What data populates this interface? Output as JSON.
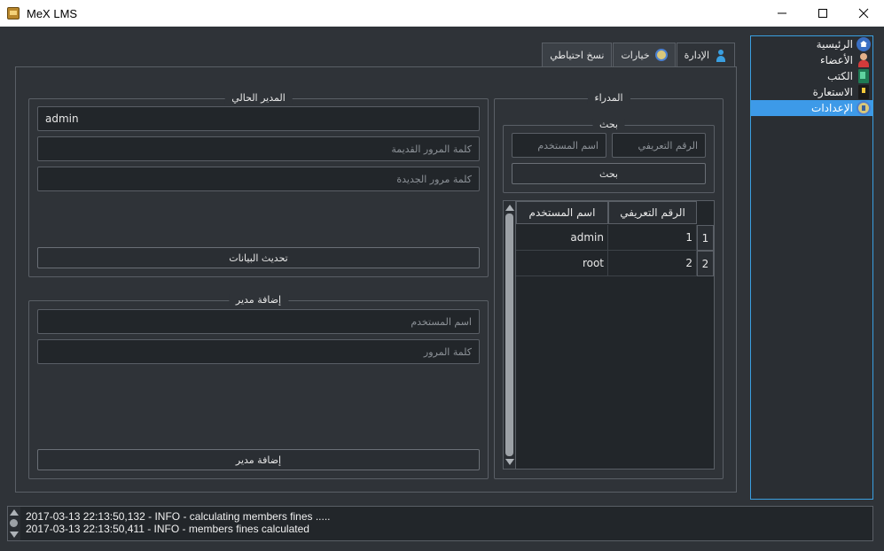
{
  "window": {
    "title": "MeX LMS",
    "controls": {
      "minimize": "—",
      "maximize": "☐",
      "close": "✕"
    }
  },
  "nav": {
    "items": [
      {
        "label": "الرئيسية",
        "icon": "home-icon"
      },
      {
        "label": "الأعضاء",
        "icon": "member-icon"
      },
      {
        "label": "الكتب",
        "icon": "book-icon"
      },
      {
        "label": "الاستعارة",
        "icon": "borrow-icon"
      },
      {
        "label": "الإعدادات",
        "icon": "settings-icon",
        "active": true
      }
    ]
  },
  "tabs": [
    {
      "label": "الإدارة",
      "icon": "user-icon",
      "active": true
    },
    {
      "label": "خيارات",
      "icon": "gear-icon"
    },
    {
      "label": "نسخ احتياطي"
    }
  ],
  "current_admin": {
    "title": "المدير الحالي",
    "username_value": "admin",
    "old_password_placeholder": "كلمة المرور القديمة",
    "new_password_placeholder": "كلمة مرور الجديدة",
    "update_button": "تحديث البيانات"
  },
  "add_admin": {
    "title": "إضافة مدير",
    "username_placeholder": "اسم المستخدم",
    "password_placeholder": "كلمة المرور",
    "add_button": "إضافة مدير"
  },
  "admins": {
    "title": "المدراء",
    "search": {
      "title": "بحث",
      "username_placeholder": "اسم المستخدم",
      "id_placeholder": "الرقم التعريفي",
      "button": "بحث"
    },
    "table": {
      "columns": [
        "اسم المستخدم",
        "الرقم التعريفي"
      ],
      "rows": [
        {
          "row_number": "1",
          "username": "admin",
          "id": "1"
        },
        {
          "row_number": "2",
          "username": "root",
          "id": "2"
        }
      ]
    }
  },
  "log": {
    "lines": [
      "2017-03-13 22:13:50,132 - INFO - calculating members fines .....",
      "2017-03-13 22:13:50,411 - INFO - members fines calculated"
    ]
  },
  "colors": {
    "background": "#2f3338",
    "accent": "#3d9ae8",
    "border": "#5a5f66"
  }
}
